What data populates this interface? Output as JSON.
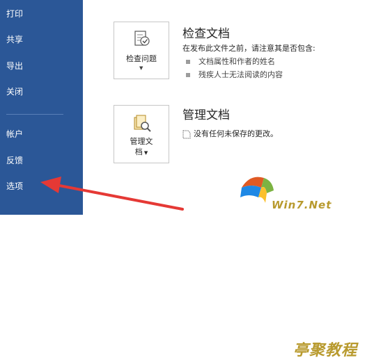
{
  "sidebar": {
    "items": [
      {
        "label": "打印"
      },
      {
        "label": "共享"
      },
      {
        "label": "导出"
      },
      {
        "label": "关闭"
      },
      {
        "label": "帐户"
      },
      {
        "label": "反馈"
      },
      {
        "label": "选项"
      }
    ]
  },
  "inspect": {
    "tile_label": "检查问题",
    "title": "检查文档",
    "description": "在发布此文件之前，请注意其是否包含:",
    "bullets": [
      "文档属性和作者的姓名",
      "残疾人士无法阅读的内容"
    ]
  },
  "manage": {
    "tile_label_line1": "管理文",
    "tile_label_line2": "档",
    "title": "管理文档",
    "status": "没有任何未保存的更改。"
  },
  "watermark": {
    "top_text": "亭聚教程",
    "bottom_text": "Win7.Net"
  },
  "colors": {
    "sidebar_bg": "#2b5797",
    "arrow": "#e53935"
  }
}
